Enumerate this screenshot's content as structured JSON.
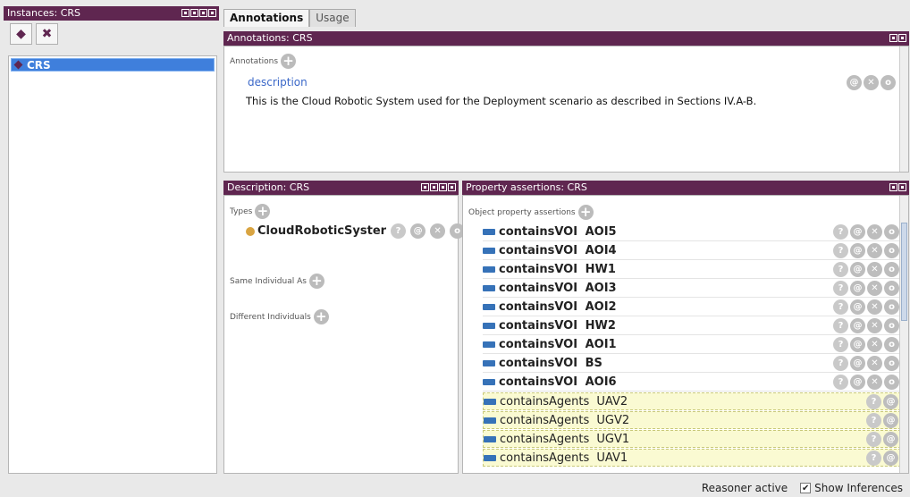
{
  "instances_panel": {
    "title": "Instances: CRS",
    "items": [
      {
        "label": "CRS",
        "selected": true
      }
    ]
  },
  "tabs": [
    {
      "label": "Annotations",
      "active": true
    },
    {
      "label": "Usage",
      "active": false
    }
  ],
  "annotations_panel": {
    "title": "Annotations: CRS",
    "section_label": "Annotations",
    "property": "description",
    "value": "This is the Cloud Robotic System used for the Deployment scenario as described in Sections IV.A-B."
  },
  "description_panel": {
    "title": "Description: CRS",
    "types_label": "Types",
    "type_value": "CloudRoboticSyster",
    "same_label": "Same Individual As",
    "different_label": "Different Individuals"
  },
  "property_panel": {
    "title": "Property assertions: CRS",
    "section_label": "Object property assertions",
    "rows": [
      {
        "prop": "containsVOI",
        "value": "AOI5",
        "inferred": false
      },
      {
        "prop": "containsVOI",
        "value": "AOI4",
        "inferred": false
      },
      {
        "prop": "containsVOI",
        "value": "HW1",
        "inferred": false
      },
      {
        "prop": "containsVOI",
        "value": "AOI3",
        "inferred": false
      },
      {
        "prop": "containsVOI",
        "value": "AOI2",
        "inferred": false
      },
      {
        "prop": "containsVOI",
        "value": "HW2",
        "inferred": false
      },
      {
        "prop": "containsVOI",
        "value": "AOI1",
        "inferred": false
      },
      {
        "prop": "containsVOI",
        "value": "BS",
        "inferred": false
      },
      {
        "prop": "containsVOI",
        "value": "AOI6",
        "inferred": false
      },
      {
        "prop": "containsAgents",
        "value": "UAV2",
        "inferred": true
      },
      {
        "prop": "containsAgents",
        "value": "UGV2",
        "inferred": true
      },
      {
        "prop": "containsAgents",
        "value": "UGV1",
        "inferred": true
      },
      {
        "prop": "containsAgents",
        "value": "UAV1",
        "inferred": true
      }
    ]
  },
  "status": {
    "reasoner": "Reasoner active",
    "show_inferences": "Show Inferences",
    "show_inferences_checked": true
  },
  "colors": {
    "header": "#5f2650",
    "selection": "#3f7fdc",
    "object_property": "#3672b8",
    "inferred_bg": "#fafad2",
    "individual_type": "#d9a441"
  }
}
